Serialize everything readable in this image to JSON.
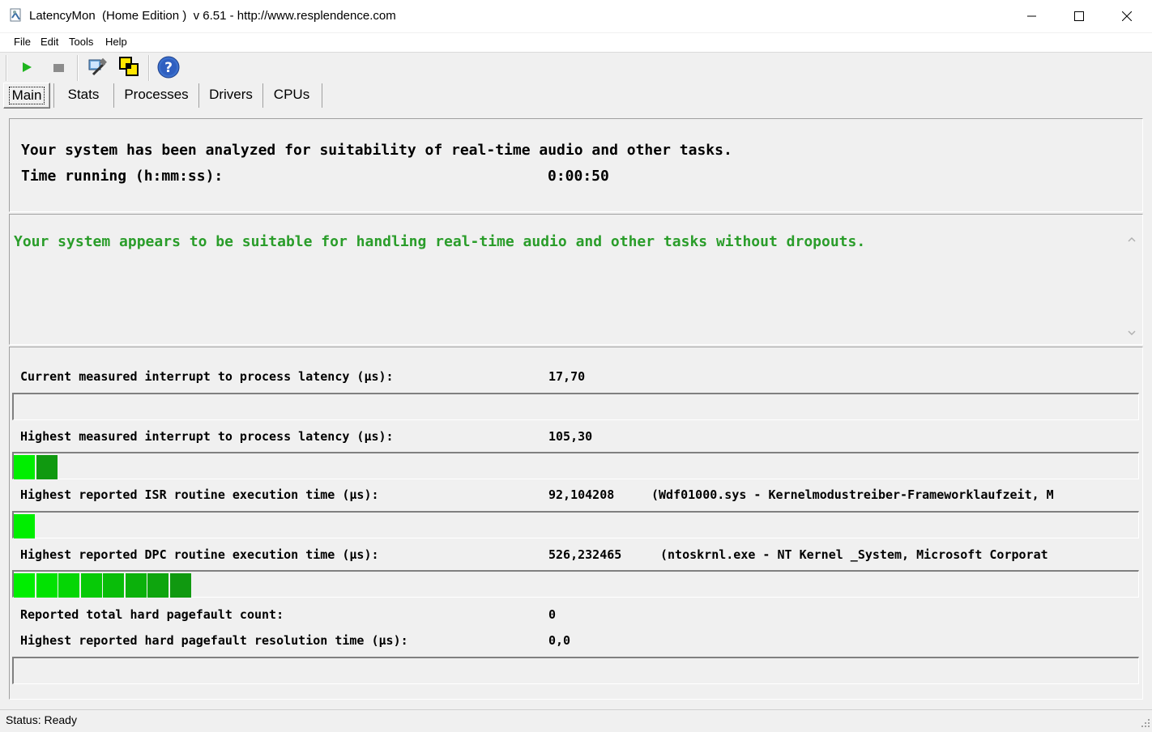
{
  "window": {
    "title": "LatencyMon  (Home Edition )  v 6.51 - http://www.resplendence.com"
  },
  "menu": [
    "File",
    "Edit",
    "Tools",
    "Help"
  ],
  "tabs": [
    "Main",
    "Stats",
    "Processes",
    "Drivers",
    "CPUs"
  ],
  "summary": {
    "line1": "Your system has been analyzed for suitability of real-time audio and other tasks.",
    "time_label": "Time running (h:mm:ss):",
    "time_value": "0:00:50"
  },
  "verdict": {
    "text": "Your system appears to be suitable for handling real-time audio and other tasks without dropouts.",
    "color": "#2a9d2a"
  },
  "metrics": [
    {
      "label": "Current measured interrupt to process latency (µs):",
      "value": "17,70",
      "detail": "",
      "bar_segments": 0
    },
    {
      "label": "Highest measured interrupt to process latency (µs):",
      "value": "105,30",
      "detail": "",
      "bar_segments": 2
    },
    {
      "label": "Highest reported ISR routine execution time (µs):",
      "value": "92,104208",
      "detail": "(Wdf01000.sys - Kernelmodustreiber-Frameworklaufzeit, M",
      "bar_segments": 1
    },
    {
      "label": "Highest reported DPC routine execution time (µs):",
      "value": "526,232465",
      "detail": "(ntoskrnl.exe - NT Kernel _System, Microsoft Corporat",
      "bar_segments": 8
    },
    {
      "label": "Reported total hard pagefault count:",
      "value": "0",
      "detail": ""
    },
    {
      "label": "Highest reported hard pagefault resolution time (µs):",
      "value": "0,0",
      "detail": "",
      "bar_segments": 0
    }
  ],
  "status": "Status: Ready",
  "colors": {
    "bar_green_light": "#00ee00",
    "bar_green_dark": "#109910"
  }
}
